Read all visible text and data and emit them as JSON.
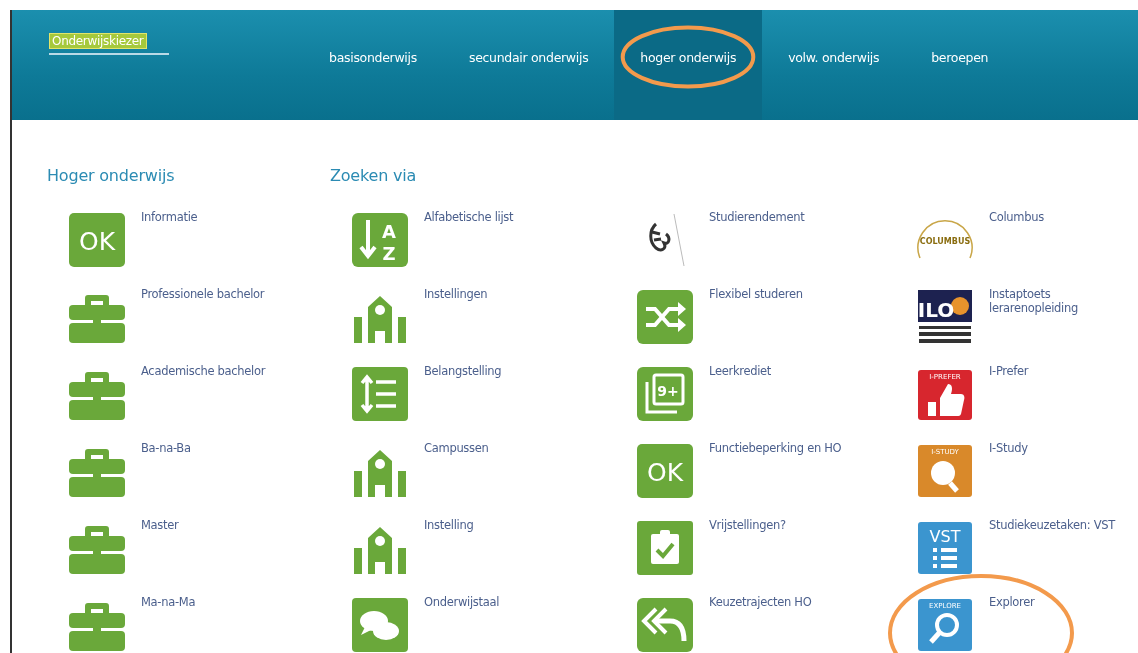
{
  "header": {
    "logo": {
      "text": "Onderwijskiezer"
    },
    "nav": [
      {
        "label": "basisonderwijs",
        "selected": false,
        "circled": false
      },
      {
        "label": "secundair onderwijs",
        "selected": false,
        "circled": false
      },
      {
        "label": "hoger onderwijs",
        "selected": true,
        "circled": true
      },
      {
        "label": "volw. onderwijs",
        "selected": false,
        "circled": false
      },
      {
        "label": "beroepen",
        "selected": false,
        "circled": false
      }
    ]
  },
  "columns": [
    {
      "heading": "Hoger onderwijs",
      "tiles": [
        {
          "label": "Informatie",
          "kind": "ok",
          "icon_text": [
            "OK"
          ],
          "circled": false
        },
        {
          "label": "Professionele bachelor",
          "kind": "briefcase",
          "circled": false
        },
        {
          "label": "Academische bachelor",
          "kind": "briefcase",
          "circled": false
        },
        {
          "label": "Ba-na-Ba",
          "kind": "briefcase",
          "circled": false
        },
        {
          "label": "Master",
          "kind": "briefcase",
          "circled": false
        },
        {
          "label": "Ma-na-Ma",
          "kind": "briefcase",
          "circled": false
        }
      ]
    },
    {
      "heading": "Zoeken via",
      "tiles": [
        {
          "label": "Alfabetische lijst",
          "kind": "az",
          "icon_text": [
            "A",
            "Z"
          ],
          "circled": false
        },
        {
          "label": "Instellingen",
          "kind": "building",
          "circled": false
        },
        {
          "label": "Belangstelling",
          "kind": "list",
          "circled": false
        },
        {
          "label": "Campussen",
          "kind": "building",
          "circled": false
        },
        {
          "label": "Instelling",
          "kind": "building",
          "circled": false
        },
        {
          "label": "Onderwijstaal",
          "kind": "chat",
          "circled": false
        }
      ]
    },
    {
      "tiles": [
        {
          "label": "Studierendement",
          "kind": "emblem",
          "circled": false
        },
        {
          "label": "Flexibel studeren",
          "kind": "shuffle",
          "circled": false
        },
        {
          "label": "Leerkrediet",
          "kind": "cards",
          "icon_text": [
            "9+"
          ],
          "circled": false
        },
        {
          "label": "Functiebeperking en HO",
          "kind": "ok",
          "icon_text": [
            "OK"
          ],
          "circled": false
        },
        {
          "label": "Vrijstellingen?",
          "kind": "clipboard",
          "circled": false
        },
        {
          "label": "Keuzetrajecten HO",
          "kind": "reply",
          "circled": false
        }
      ]
    },
    {
      "tiles": [
        {
          "label": "Columbus",
          "kind": "columbus",
          "icon_text": [
            "COLUMBUS"
          ],
          "circled": false
        },
        {
          "label": "Instaptoets lerarenopleiding",
          "kind": "ilo",
          "icon_text": [
            "ILO"
          ],
          "circled": false
        },
        {
          "label": "I-Prefer",
          "kind": "thumb",
          "icon_text": [
            "I-PREFER"
          ],
          "circled": false
        },
        {
          "label": "I-Study",
          "kind": "bulb",
          "icon_text": [
            "I-STUDY"
          ],
          "circled": false
        },
        {
          "label": "Studiekeuzetaken: VST",
          "kind": "vst",
          "icon_text": [
            "VST"
          ],
          "circled": false
        },
        {
          "label": "Explorer",
          "kind": "explore",
          "icon_text": [
            "EXPLORE"
          ],
          "circled": true
        }
      ]
    }
  ]
}
